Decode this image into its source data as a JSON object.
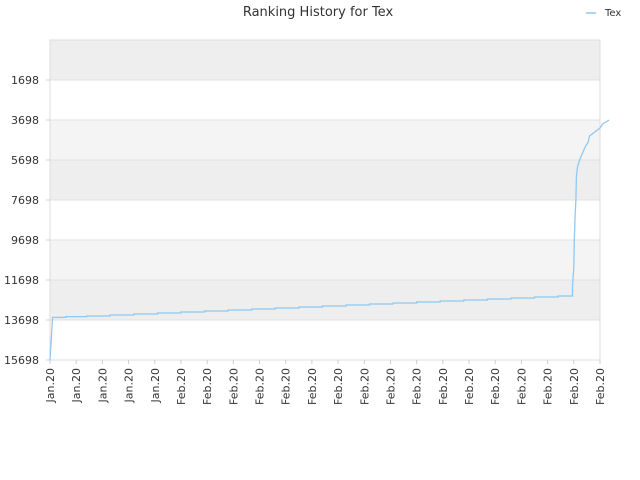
{
  "chart_data": {
    "type": "line",
    "title": "Ranking History for Tex",
    "xlabel": "",
    "ylabel": "",
    "y_reversed": true,
    "ylim": [
      15698,
      -302
    ],
    "yticks": [
      1698,
      3698,
      5698,
      7698,
      9698,
      11698,
      13698,
      15698
    ],
    "xtick_labels": [
      "Jan.20",
      "Jan.20",
      "Jan.20",
      "Jan.20",
      "Jan.20",
      "Feb.20",
      "Feb.20",
      "Feb.20",
      "Feb.20",
      "Feb.20",
      "Feb.20",
      "Feb.20",
      "Feb.20",
      "Feb.20",
      "Feb.20",
      "Feb.20",
      "Feb.20",
      "Feb.20",
      "Feb.20",
      "Feb.20",
      "Feb.20",
      "Feb.20"
    ],
    "legend": {
      "position": "top-right",
      "entries": [
        "Tex"
      ]
    },
    "grid": true,
    "band_colors": [
      "#eeeeee",
      "#ffffff",
      "#f4f4f4"
    ],
    "series": [
      {
        "name": "Tex",
        "color": "#90c8f2",
        "points": [
          [
            0,
            15698
          ],
          [
            0.1,
            13570
          ],
          [
            0.6,
            13570
          ],
          [
            0.6,
            13530
          ],
          [
            1.4,
            13530
          ],
          [
            1.4,
            13500
          ],
          [
            2.3,
            13500
          ],
          [
            2.3,
            13450
          ],
          [
            3.2,
            13450
          ],
          [
            3.2,
            13400
          ],
          [
            4.1,
            13400
          ],
          [
            4.1,
            13350
          ],
          [
            5.0,
            13350
          ],
          [
            5.0,
            13300
          ],
          [
            5.9,
            13300
          ],
          [
            5.9,
            13250
          ],
          [
            6.8,
            13250
          ],
          [
            6.8,
            13200
          ],
          [
            7.7,
            13200
          ],
          [
            7.7,
            13150
          ],
          [
            8.6,
            13150
          ],
          [
            8.6,
            13100
          ],
          [
            9.5,
            13100
          ],
          [
            9.5,
            13050
          ],
          [
            10.4,
            13050
          ],
          [
            10.4,
            13000
          ],
          [
            11.3,
            13000
          ],
          [
            11.3,
            12950
          ],
          [
            12.2,
            12950
          ],
          [
            12.2,
            12900
          ],
          [
            13.1,
            12900
          ],
          [
            13.1,
            12850
          ],
          [
            14.0,
            12850
          ],
          [
            14.0,
            12800
          ],
          [
            14.9,
            12800
          ],
          [
            14.9,
            12750
          ],
          [
            15.8,
            12750
          ],
          [
            15.8,
            12700
          ],
          [
            16.7,
            12700
          ],
          [
            16.7,
            12650
          ],
          [
            17.6,
            12650
          ],
          [
            17.6,
            12600
          ],
          [
            18.5,
            12600
          ],
          [
            18.5,
            12550
          ],
          [
            19.4,
            12550
          ],
          [
            19.4,
            12500
          ],
          [
            19.95,
            12500
          ],
          [
            19.95,
            12000
          ],
          [
            20.0,
            11100
          ],
          [
            20.02,
            9700
          ],
          [
            20.05,
            8500
          ],
          [
            20.08,
            7700
          ],
          [
            20.1,
            6500
          ],
          [
            20.15,
            6000
          ],
          [
            20.2,
            5800
          ],
          [
            20.25,
            5600
          ],
          [
            20.35,
            5300
          ],
          [
            20.45,
            5000
          ],
          [
            20.55,
            4800
          ],
          [
            20.6,
            4500
          ],
          [
            20.8,
            4300
          ],
          [
            21.0,
            4100
          ],
          [
            21.1,
            3900
          ],
          [
            21.35,
            3700
          ]
        ]
      }
    ]
  }
}
